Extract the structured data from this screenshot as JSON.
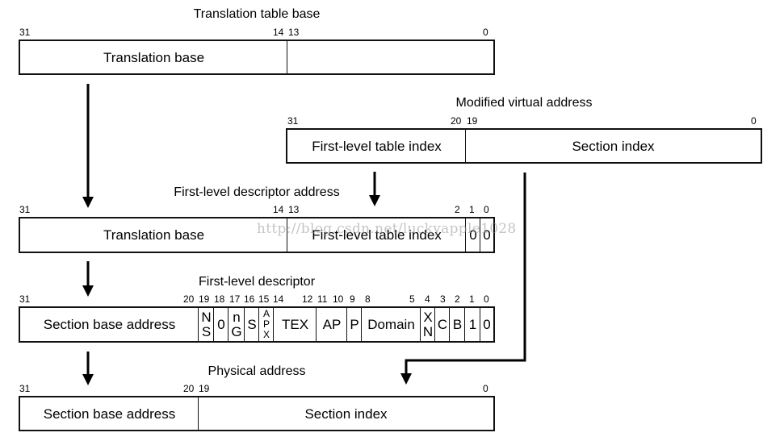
{
  "diagram": {
    "translation_table_base": {
      "title": "Translation table base",
      "bits": {
        "b31": "31",
        "b14": "14",
        "b13": "13",
        "b0": "0"
      },
      "fields": {
        "translation_base": "Translation base",
        "unused": ""
      }
    },
    "modified_virtual_address": {
      "title": "Modified virtual address",
      "bits": {
        "b31": "31",
        "b20": "20",
        "b19": "19",
        "b0": "0"
      },
      "fields": {
        "first_level_table_index": "First-level table index",
        "section_index": "Section index"
      }
    },
    "first_level_descriptor_address": {
      "title": "First-level descriptor address",
      "bits": {
        "b31": "31",
        "b14": "14",
        "b13": "13",
        "b2": "2",
        "b1": "1",
        "b0": "0"
      },
      "fields": {
        "translation_base": "Translation base",
        "first_level_table_index": "First-level table index",
        "bit1": "0",
        "bit0": "0"
      }
    },
    "first_level_descriptor": {
      "title": "First-level descriptor",
      "bits": {
        "b31": "31",
        "b20": "20",
        "b19": "19",
        "b18": "18",
        "b17": "17",
        "b16": "16",
        "b15": "15",
        "b14": "14",
        "b12": "12",
        "b11": "11",
        "b10": "10",
        "b9": "9",
        "b8": "8",
        "b5": "5",
        "b4": "4",
        "b3": "3",
        "b2": "2",
        "b1": "1",
        "b0": "0"
      },
      "fields": {
        "section_base_address": "Section base address",
        "ns": [
          "N",
          "S"
        ],
        "zero": "0",
        "ng": [
          "n",
          "G"
        ],
        "s": "S",
        "apx": [
          "A",
          "P",
          "X"
        ],
        "tex": "TEX",
        "ap": "AP",
        "p": "P",
        "domain": "Domain",
        "xn": [
          "X",
          "N"
        ],
        "c": "C",
        "b": "B",
        "one": "1",
        "bit0": "0"
      }
    },
    "physical_address": {
      "title": "Physical address",
      "bits": {
        "b31": "31",
        "b20": "20",
        "b19": "19",
        "b0": "0"
      },
      "fields": {
        "section_base_address": "Section base address",
        "section_index": "Section index"
      }
    },
    "watermark": "http://blog.csdn.net/luckyapple1028"
  }
}
